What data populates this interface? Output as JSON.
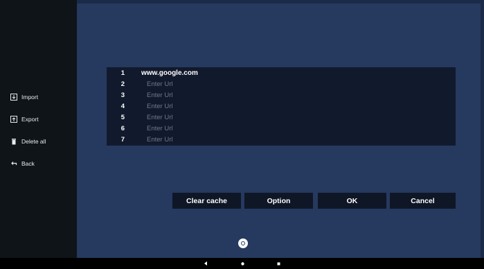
{
  "sidebar": {
    "items": [
      {
        "label": "Import",
        "icon": "import-icon"
      },
      {
        "label": "Export",
        "icon": "export-icon"
      },
      {
        "label": "Delete all",
        "icon": "trash-icon"
      },
      {
        "label": "Back",
        "icon": "back-arrow-icon"
      }
    ]
  },
  "url_list": {
    "rows": [
      {
        "num": "1",
        "value": "www.google.com"
      },
      {
        "num": "2",
        "placeholder": "Enter Url"
      },
      {
        "num": "3",
        "placeholder": "Enter Url"
      },
      {
        "num": "4",
        "placeholder": "Enter Url"
      },
      {
        "num": "5",
        "placeholder": "Enter Url"
      },
      {
        "num": "6",
        "placeholder": "Enter Url"
      },
      {
        "num": "7",
        "placeholder": "Enter Url"
      }
    ]
  },
  "buttons": {
    "clear_cache": "Clear cache",
    "option": "Option",
    "ok": "OK",
    "cancel": "Cancel"
  },
  "colors": {
    "sidebar_bg": "#0f1418",
    "main_bg": "#26395f",
    "list_bg": "#111a2c",
    "button_bg": "#0f1626"
  }
}
